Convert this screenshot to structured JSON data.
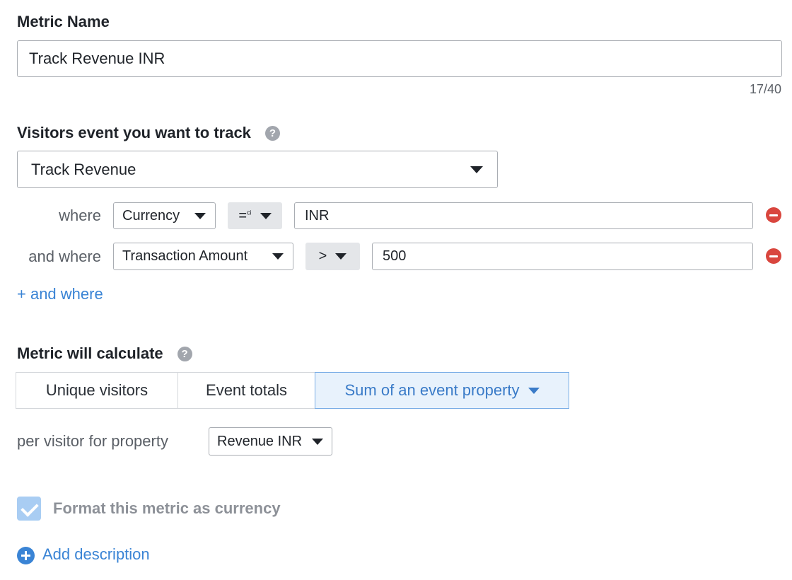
{
  "metric_name": {
    "label": "Metric Name",
    "value": "Track Revenue INR",
    "counter": "17/40"
  },
  "event": {
    "label": "Visitors event you want to track",
    "help_icon": "?",
    "selected": "Track Revenue"
  },
  "conditions": [
    {
      "prefix": "where",
      "property": "Currency",
      "operator": "=",
      "operator_sup": "ci",
      "value": "INR"
    },
    {
      "prefix": "and where",
      "property": "Transaction Amount",
      "operator": ">",
      "value": "500"
    }
  ],
  "add_condition_label": "+ and where",
  "calculate": {
    "label": "Metric will calculate",
    "help_icon": "?",
    "options": [
      "Unique visitors",
      "Event totals",
      "Sum of an event property"
    ],
    "selected": "Sum of an event property"
  },
  "per_visitor": {
    "label": "per visitor for property",
    "property": "Revenue INR"
  },
  "currency_format": {
    "label": "Format this metric as currency",
    "checked": true,
    "disabled": true
  },
  "add_description_label": "Add description",
  "colors": {
    "accent": "#3a84d5",
    "danger": "#d9463e",
    "selected_bg": "#e8f2fc"
  }
}
